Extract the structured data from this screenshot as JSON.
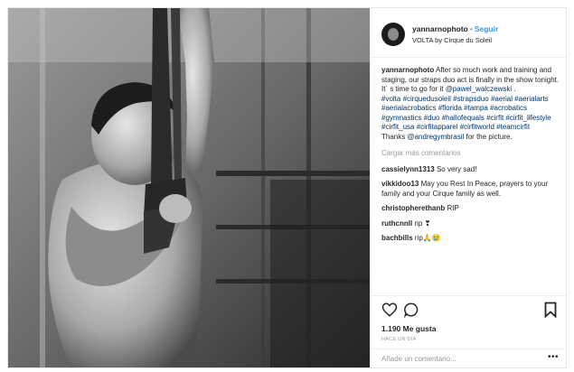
{
  "post": {
    "username": "yannarnophoto",
    "separator": "•",
    "follow_label": "Seguir",
    "location": "VOLTA by Cirque du Soleil",
    "caption": {
      "username": "yannarnophoto",
      "text_1": "After so much work and training and staging, our straps duo act is finally in the show tonight. It´ s time to go for it ",
      "mention": "@pawel_walczewski",
      "text_2": " .",
      "hashtags": "#volta #cirquedusoleil #strapsduo #aerial #aerialarts #aerialacrobatics #florida #tampa #acrobatics #gymnastics #duo #hallofequals #cirfit #cirfit_lifestyle #cirfit_usa #cirfitapparel #cirfitworld #teamcirfit",
      "thanks_1": "Thanks ",
      "thanks_mention": "@andregymbrasil",
      "thanks_2": " for the picture."
    },
    "load_more": "Cargar más comentarios",
    "comments": [
      {
        "user": "cassielynn1313",
        "text": "So very sad!"
      },
      {
        "user": "vikkidoo13",
        "text": "May you Rest In Peace, prayers to your family and your Cirque family as well."
      },
      {
        "user": "christopherethanb",
        "text": "RIP"
      },
      {
        "user": "ruthcnnll",
        "text": "rip ❣"
      },
      {
        "user": "bachbills",
        "text": "rip🙏😢"
      }
    ],
    "likes": "1.190 Me gusta",
    "time": "HACE UN DÍA",
    "add_comment_placeholder": "Añade un comentario...",
    "more_label": "•••"
  },
  "icons": {
    "like": "heart-outline-icon",
    "comment": "speech-bubble-icon",
    "save": "bookmark-icon",
    "more": "ellipsis-icon"
  }
}
